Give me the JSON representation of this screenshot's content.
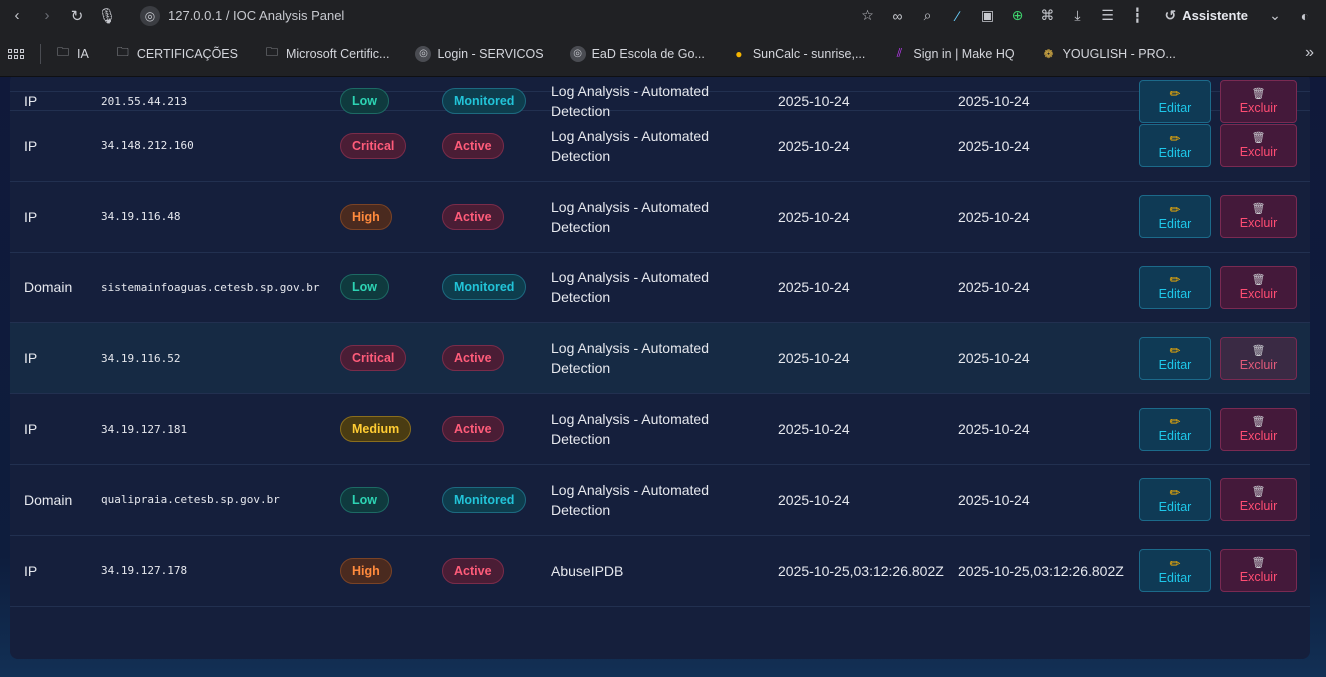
{
  "browser": {
    "url": "127.0.0.1 / IOC Analysis Panel",
    "assistant_label": "Assistente",
    "bookmarks": [
      {
        "label": "IA",
        "icon": "folder-icon"
      },
      {
        "label": "CERTIFICAÇÕES",
        "icon": "folder-icon"
      },
      {
        "label": "Microsoft Certific...",
        "icon": "folder-icon"
      },
      {
        "label": "Login - SERVICOS",
        "icon": "globe-icon"
      },
      {
        "label": "EaD Escola de Go...",
        "icon": "globe-icon"
      },
      {
        "label": "SunCalc - sunrise,...",
        "icon": "sun-icon"
      },
      {
        "label": "Sign in | Make HQ",
        "icon": "make-logo-icon"
      },
      {
        "label": "YOUGLISH - PRO...",
        "icon": "youglish-icon"
      }
    ]
  },
  "table": {
    "edit_label": "Editar",
    "delete_label": "Excluir",
    "rows": [
      {
        "type": "IP",
        "value": "201.55.44.213",
        "severity": "Low",
        "severity_class": "sev-low",
        "status": "Monitored",
        "status_class": "st-monitored",
        "source": "Log Analysis - Automated Detection",
        "first_seen": "2025-10-24",
        "last_seen": "2025-10-24"
      },
      {
        "type": "IP",
        "value": "34.148.212.160",
        "severity": "Critical",
        "severity_class": "sev-critical",
        "status": "Active",
        "status_class": "st-active",
        "source": "Log Analysis - Automated Detection",
        "first_seen": "2025-10-24",
        "last_seen": "2025-10-24"
      },
      {
        "type": "IP",
        "value": "34.19.116.48",
        "severity": "High",
        "severity_class": "sev-high",
        "status": "Active",
        "status_class": "st-active",
        "source": "Log Analysis - Automated Detection",
        "first_seen": "2025-10-24",
        "last_seen": "2025-10-24"
      },
      {
        "type": "Domain",
        "value": "sistemainfoaguas.cetesb.sp.gov.br",
        "severity": "Low",
        "severity_class": "sev-low",
        "status": "Monitored",
        "status_class": "st-monitored",
        "source": "Log Analysis - Automated Detection",
        "first_seen": "2025-10-24",
        "last_seen": "2025-10-24"
      },
      {
        "type": "IP",
        "value": "34.19.116.52",
        "severity": "Critical",
        "severity_class": "sev-critical",
        "status": "Active",
        "status_class": "st-active",
        "source": "Log Analysis - Automated Detection",
        "first_seen": "2025-10-24",
        "last_seen": "2025-10-24"
      },
      {
        "type": "IP",
        "value": "34.19.127.181",
        "severity": "Medium",
        "severity_class": "sev-medium",
        "status": "Active",
        "status_class": "st-active",
        "source": "Log Analysis - Automated Detection",
        "first_seen": "2025-10-24",
        "last_seen": "2025-10-24"
      },
      {
        "type": "Domain",
        "value": "qualipraia.cetesb.sp.gov.br",
        "severity": "Low",
        "severity_class": "sev-low",
        "status": "Monitored",
        "status_class": "st-monitored",
        "source": "Log Analysis - Automated Detection",
        "first_seen": "2025-10-24",
        "last_seen": "2025-10-24"
      },
      {
        "type": "IP",
        "value": "34.19.127.178",
        "severity": "High",
        "severity_class": "sev-high",
        "status": "Active",
        "status_class": "st-active",
        "source": "AbuseIPDB",
        "first_seen": "2025-10-25,03:12:26.802Z",
        "last_seen": "2025-10-25,03:12:26.802Z"
      }
    ]
  }
}
